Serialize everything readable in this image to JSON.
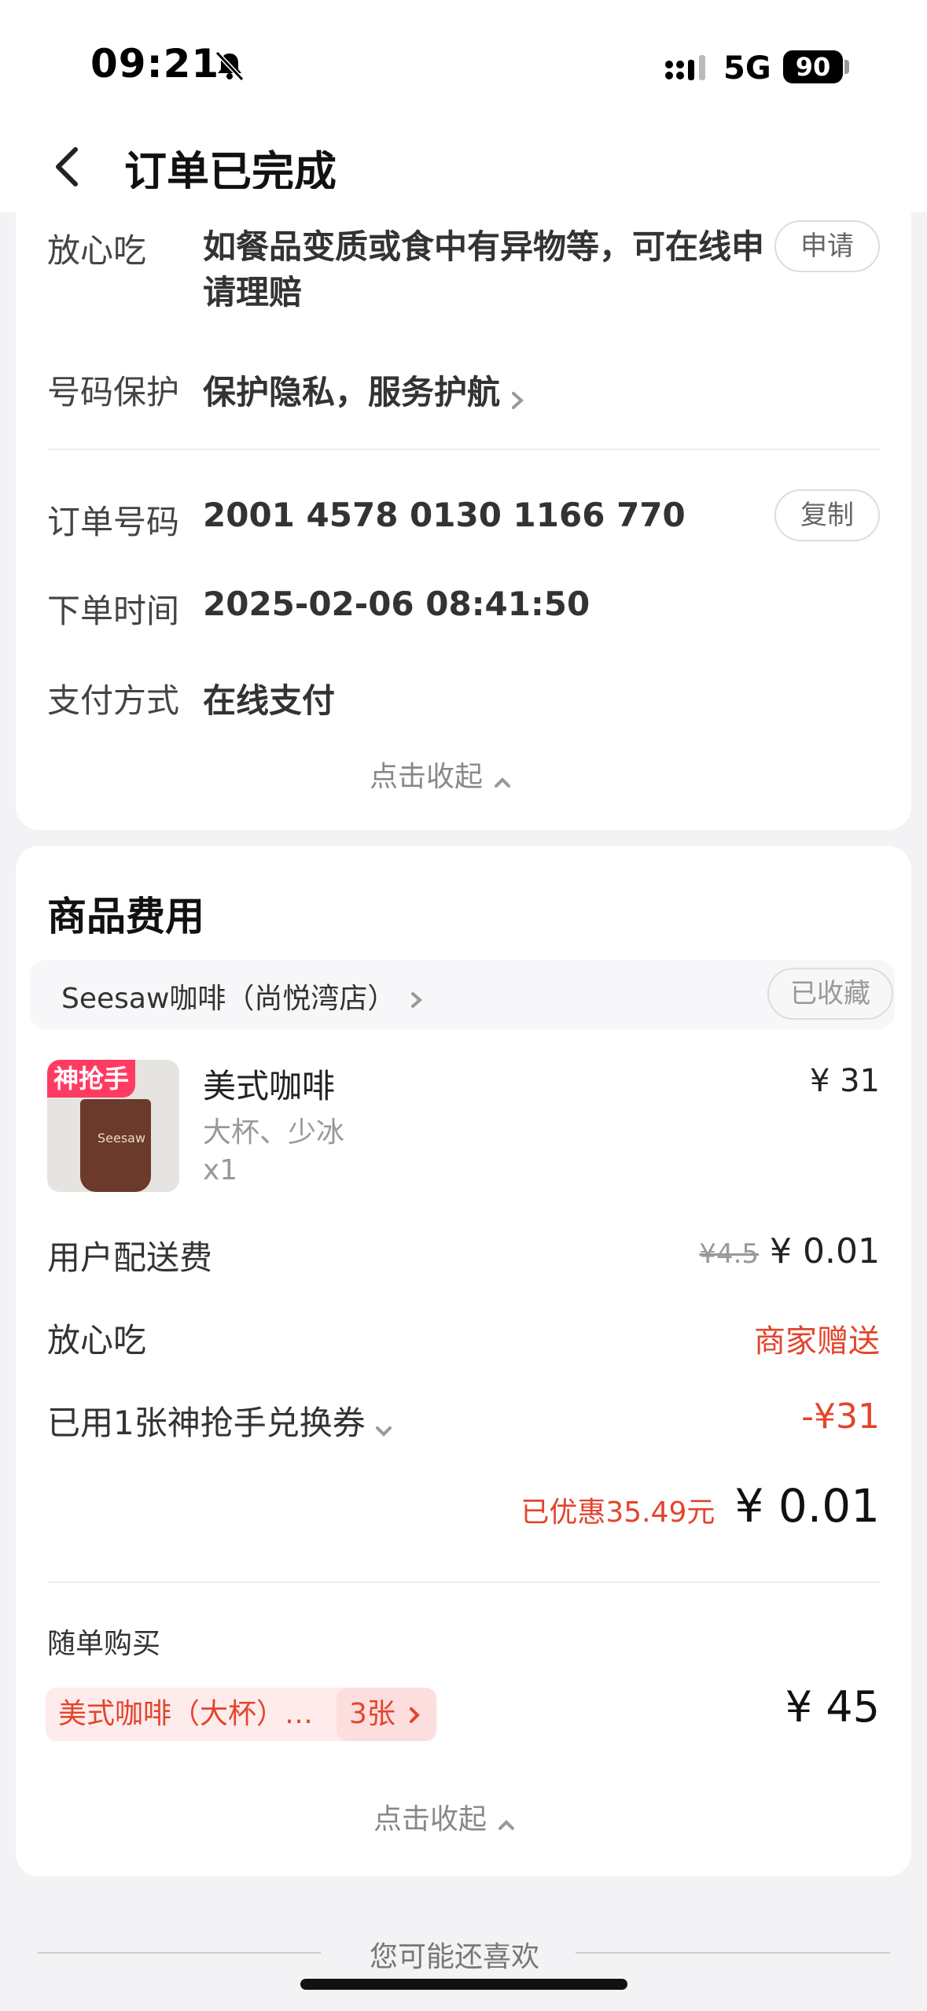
{
  "status_bar": {
    "time": "09:21",
    "network": "5G",
    "battery": "90"
  },
  "nav": {
    "title": "订单已完成"
  },
  "order_info": {
    "safe_eat_label": "放心吃",
    "safe_eat_text": "如餐品变质或食中有异物等，可在线申请理赔",
    "apply_button": "申请",
    "number_protect_label": "号码保护",
    "number_protect_text": "保护隐私，服务护航",
    "order_no_label": "订单号码",
    "order_no": "2001 4578 0130 1166 770",
    "copy_button": "复制",
    "order_time_label": "下单时间",
    "order_time": "2025-02-06 08:41:50",
    "pay_method_label": "支付方式",
    "pay_method": "在线支付",
    "collapse": "点击收起"
  },
  "goods": {
    "title": "商品费用",
    "shop_name": "Seesaw咖啡（尚悦湾店）",
    "favorited": "已收藏",
    "item": {
      "badge": "神抢手",
      "cup_brand": "Seesaw",
      "name": "美式咖啡",
      "spec": "大杯、少冰",
      "qty": "x1",
      "price": "¥ 31"
    },
    "delivery_label": "用户配送费",
    "delivery_original": "¥4.5",
    "delivery_price": "¥ 0.01",
    "safe_eat_label": "放心吃",
    "safe_eat_value": "商家赠送",
    "coupon_label": "已用1张神抢手兑换券",
    "coupon_value": "-¥31",
    "saved_text": "已优惠35.49元",
    "total": "¥ 0.01",
    "addon_label": "随单购买",
    "addon_item": "美式咖啡（大杯）…",
    "addon_count": "3张",
    "addon_price": "¥ 45",
    "collapse": "点击收起"
  },
  "recommend": {
    "text": "您可能还喜欢"
  }
}
